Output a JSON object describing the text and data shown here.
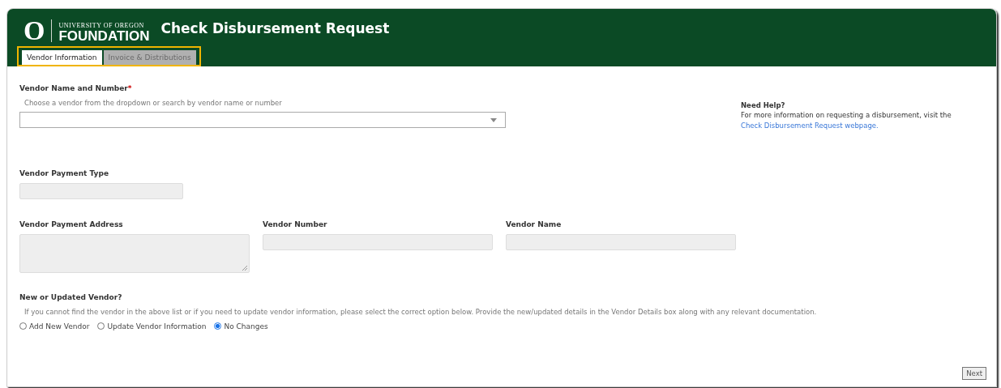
{
  "header": {
    "logo_mark": "O",
    "logo_line1": "UNIVERSITY OF OREGON",
    "logo_line2": "FOUNDATION",
    "title": "Check Disbursement Request"
  },
  "tabs": [
    {
      "label": "Vendor Information",
      "selected": true
    },
    {
      "label": "Invoice & Distributions",
      "selected": false
    }
  ],
  "vendor_select": {
    "label": "Vendor Name and Number",
    "required_mark": "*",
    "hint": "Choose a vendor from the dropdown or search by vendor name or number"
  },
  "help": {
    "title": "Need Help?",
    "text": "For more information on requesting a disbursement, visit the",
    "link": "Check Disbursement Request webpage."
  },
  "payment_type": {
    "label": "Vendor Payment Type"
  },
  "readonly_fields": [
    {
      "label": "Vendor Payment Address",
      "kind": "textarea"
    },
    {
      "label": "Vendor Number",
      "kind": "input"
    },
    {
      "label": "Vendor Name",
      "kind": "input"
    }
  ],
  "new_vendor": {
    "label": "New or Updated Vendor?",
    "hint": "If you cannot find the vendor in the above list or if you need to update vendor information, please select the correct option below. Provide the new/updated details in the Vendor Details box along with any relevant documentation.",
    "options": [
      {
        "label": "Add New Vendor",
        "selected": false
      },
      {
        "label": "Update Vendor Information",
        "selected": false
      },
      {
        "label": "No Changes",
        "selected": true
      }
    ]
  },
  "buttons": [
    "Next"
  ]
}
